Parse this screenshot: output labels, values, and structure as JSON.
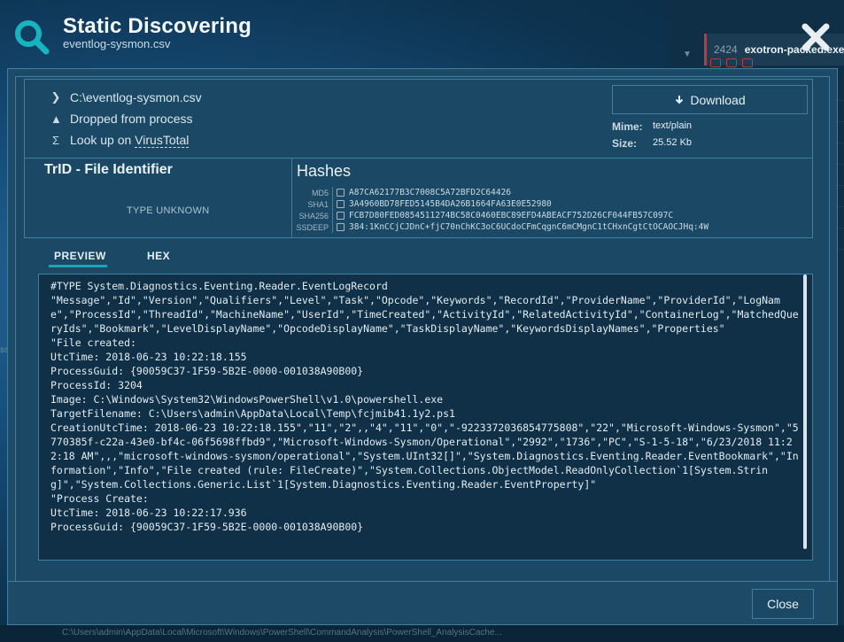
{
  "header": {
    "title": "Static Discovering",
    "subtitle": "eventlog-sysmon.csv"
  },
  "background": {
    "peek_number": "2424",
    "peek_label": "exotron-packed.exe",
    "left_peek": "ss",
    "bottom_path": "C:\\Users\\admin\\AppData\\Local\\Microsoft\\Windows\\PowerShell\\CommandAnalysis\\PowerShell_AnalysisCache..."
  },
  "file": {
    "path": "C:\\eventlog-sysmon.csv",
    "dropped": "Dropped from process",
    "virustotal_prefix": "Look up on ",
    "virustotal_link": "VirusTotal"
  },
  "download": {
    "label": "Download",
    "mime_label": "Mime:",
    "mime_value": "text/plain",
    "size_label": "Size:",
    "size_value": "25.52 Kb"
  },
  "trid": {
    "title": "TrID - File Identifier",
    "value": "TYPE UNKNOWN"
  },
  "hashes": {
    "title": "Hashes",
    "rows": [
      {
        "key": "MD5",
        "value": "A87CA62177B3C7008C5A72BFD2C64426"
      },
      {
        "key": "SHA1",
        "value": "3A4960BD78FED5145B4DA26B1664FA63E0E52980"
      },
      {
        "key": "SHA256",
        "value": "FCB7D80FED0854511274BC58C0460EBC89EFD4ABEACF752D26CF044FB57C097C"
      },
      {
        "key": "SSDEEP",
        "value": "384:1KnCCjCJDnC+fjC70nChKC3oC6UCdoCFmCqgnC6mCMgnC1tCHxnCgtCtOCAOCJHq:4W"
      }
    ]
  },
  "tabs": {
    "preview": "PREVIEW",
    "hex": "HEX"
  },
  "preview_text": "#TYPE System.Diagnostics.Eventing.Reader.EventLogRecord\n\"Message\",\"Id\",\"Version\",\"Qualifiers\",\"Level\",\"Task\",\"Opcode\",\"Keywords\",\"RecordId\",\"ProviderName\",\"ProviderId\",\"LogName\",\"ProcessId\",\"ThreadId\",\"MachineName\",\"UserId\",\"TimeCreated\",\"ActivityId\",\"RelatedActivityId\",\"ContainerLog\",\"MatchedQueryIds\",\"Bookmark\",\"LevelDisplayName\",\"OpcodeDisplayName\",\"TaskDisplayName\",\"KeywordsDisplayNames\",\"Properties\"\n\"File created:\nUtcTime: 2018-06-23 10:22:18.155\nProcessGuid: {90059C37-1F59-5B2E-0000-001038A90B00}\nProcessId: 3204\nImage: C:\\Windows\\System32\\WindowsPowerShell\\v1.0\\powershell.exe\nTargetFilename: C:\\Users\\admin\\AppData\\Local\\Temp\\fcjmib41.1y2.ps1\nCreationUtcTime: 2018-06-23 10:22:18.155\",\"11\",\"2\",,\"4\",\"11\",\"0\",\"-9223372036854775808\",\"22\",\"Microsoft-Windows-Sysmon\",\"5770385f-c22a-43e0-bf4c-06f5698ffbd9\",\"Microsoft-Windows-Sysmon/Operational\",\"2992\",\"1736\",\"PC\",\"S-1-5-18\",\"6/23/2018 11:22:18 AM\",,,\"microsoft-windows-sysmon/operational\",\"System.UInt32[]\",\"System.Diagnostics.Eventing.Reader.EventBookmark\",\"Information\",\"Info\",\"File created (rule: FileCreate)\",\"System.Collections.ObjectModel.ReadOnlyCollection`1[System.String]\",\"System.Collections.Generic.List`1[System.Diagnostics.Eventing.Reader.EventProperty]\"\n\"Process Create:\nUtcTime: 2018-06-23 10:22:17.936\nProcessGuid: {90059C37-1F59-5B2E-0000-001038A90B00}",
  "footer": {
    "close_label": "Close"
  }
}
